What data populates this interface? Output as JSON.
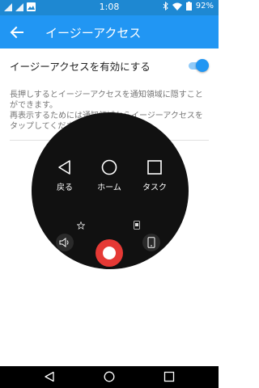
{
  "status_bar": {
    "time": "1:08",
    "battery": "92%",
    "icons": [
      "signal-icon",
      "signal-icon",
      "image-icon",
      "bluetooth-icon",
      "wifi-icon",
      "battery-icon"
    ]
  },
  "app_bar": {
    "title": "イージーアクセス",
    "back_icon": "arrow-back-icon"
  },
  "setting": {
    "label": "イージーアクセスを有効にする",
    "enabled": true,
    "accent_color": "#2196f3"
  },
  "description": {
    "line1": "長押しするとイージーアクセスを通知領域に隠すことができます。",
    "line2": "再表示するためには通知領域からイージーアクセスをタップしてください。"
  },
  "easy_access_menu": {
    "items": [
      {
        "label": "戻る",
        "icon": "triangle-back-icon"
      },
      {
        "label": "ホーム",
        "icon": "circle-home-icon"
      },
      {
        "label": "タスク",
        "icon": "square-task-icon"
      }
    ],
    "small_icons": [
      "star-icon",
      "screenshot-icon",
      "volume-icon",
      "phone-icon"
    ],
    "record_icon": "record-icon",
    "record_color": "#e53935"
  },
  "nav_bar": {
    "buttons": [
      "back-triangle-icon",
      "home-circle-icon",
      "recent-square-icon"
    ]
  }
}
